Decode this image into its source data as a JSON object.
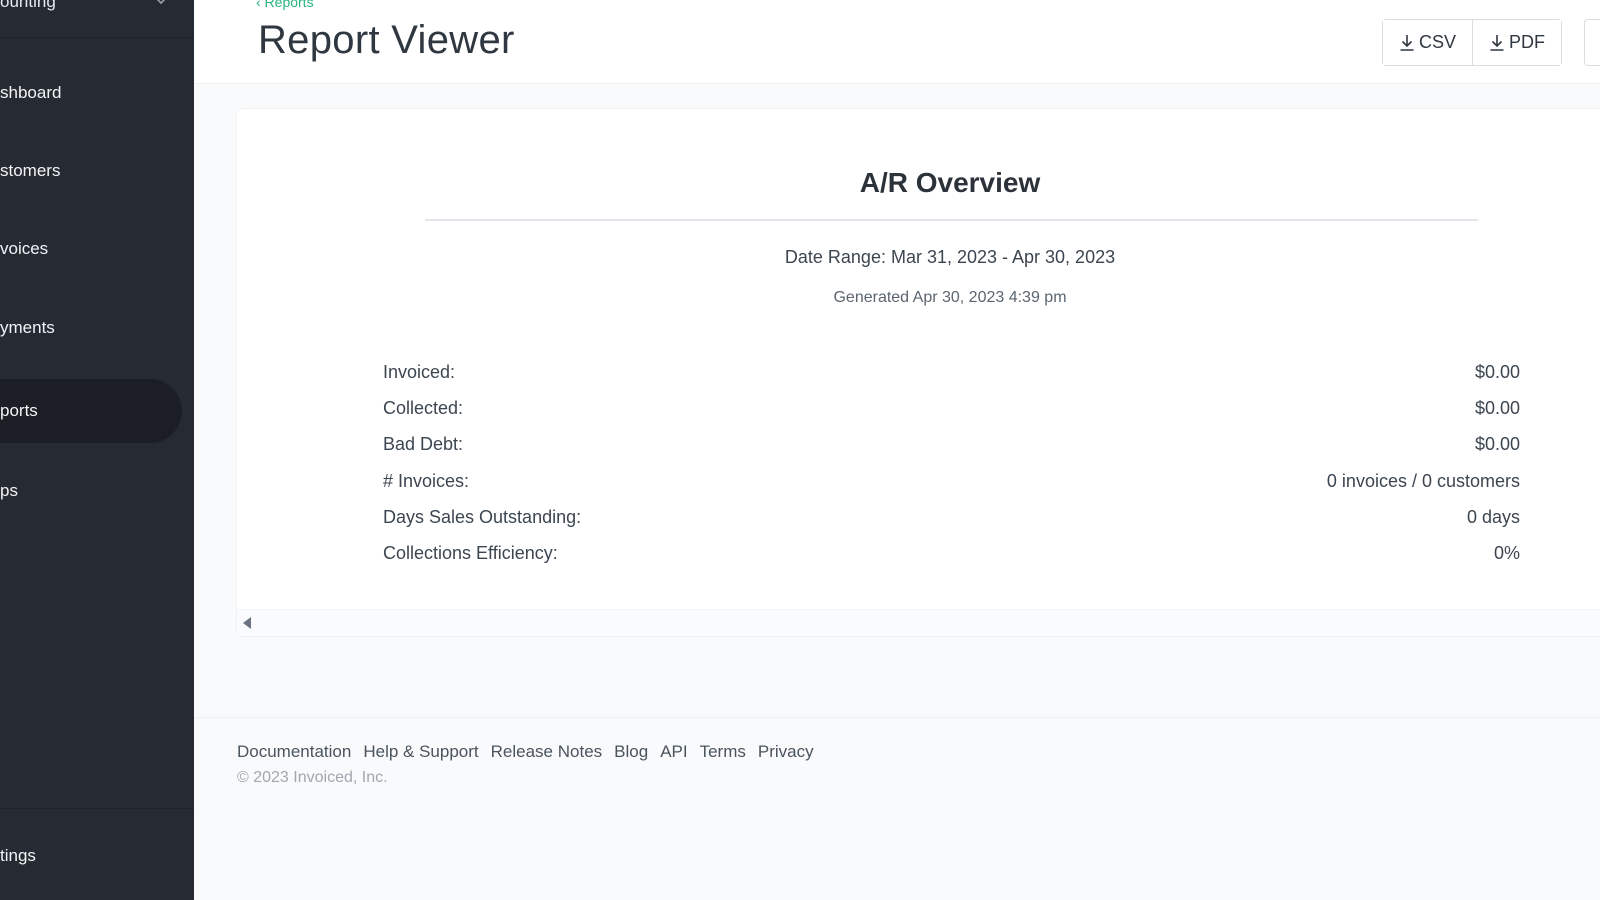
{
  "sidebar": {
    "org_name": "ounting",
    "items": [
      {
        "label": "shboard",
        "active": false
      },
      {
        "label": "stomers",
        "active": false
      },
      {
        "label": "voices",
        "active": false
      },
      {
        "label": "yments",
        "active": false
      },
      {
        "label": "ports",
        "active": true
      },
      {
        "label": "ps",
        "active": false
      }
    ],
    "settings_label": "tings"
  },
  "header": {
    "breadcrumb": "‹ Reports",
    "title": "Report Viewer",
    "buttons": {
      "csv_label": "CSV",
      "pdf_label": "PDF"
    }
  },
  "report": {
    "title": "A/R Overview",
    "date_range": "Date Range: Mar 31, 2023 - Apr 30, 2023",
    "generated": "Generated Apr 30, 2023 4:39 pm",
    "metrics": [
      {
        "label": "Invoiced:",
        "value": "$0.00"
      },
      {
        "label": "Collected:",
        "value": "$0.00"
      },
      {
        "label": "Bad Debt:",
        "value": "$0.00"
      },
      {
        "label": "# Invoices:",
        "value": "0 invoices / 0 customers"
      },
      {
        "label": "Days Sales Outstanding:",
        "value": "0 days"
      },
      {
        "label": "Collections Efficiency:",
        "value": "0%"
      }
    ]
  },
  "footer": {
    "links": [
      "Documentation",
      "Help & Support",
      "Release Notes",
      "Blog",
      "API",
      "Terms",
      "Privacy"
    ],
    "copyright": "© 2023 Invoiced, Inc."
  },
  "colors": {
    "sidebar_bg": "#262b33",
    "accent": "#26b57a"
  }
}
